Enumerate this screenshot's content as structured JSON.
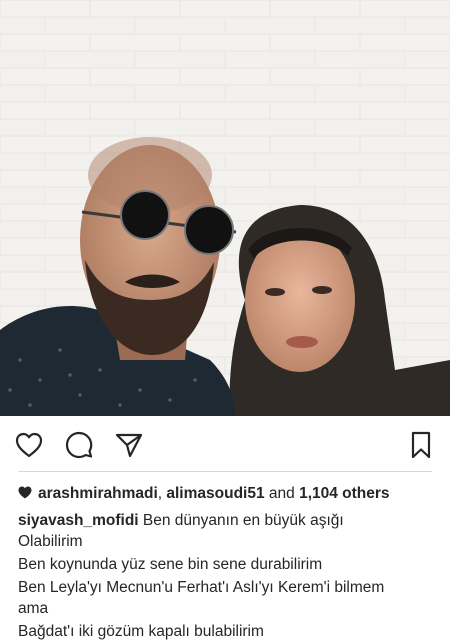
{
  "post": {
    "likes": {
      "user_1": "arashmirahmadi",
      "separator": ", ",
      "user_2": "alimasoudi51",
      "and_text": " and ",
      "others_text": "1,104 others"
    },
    "caption": {
      "author": "siyavash_mofidi",
      "line_1": "Ben dünyanın en büyük aşığı",
      "line_2": "Olabilirim",
      "line_3": "Ben koynunda yüz sene bin sene durabilirim",
      "line_4": "Ben Leyla'yı Mecnun'u Ferhat'ı Aslı'yı Kerem'i bilmem",
      "line_5": "ama",
      "line_6": "Bağdat'ı iki gözüm kapalı bulabilirim"
    }
  },
  "icons": {
    "like": "heart-outline-icon",
    "comment": "speech-bubble-icon",
    "share": "paper-plane-icon",
    "save": "bookmark-icon",
    "likes_marker": "heart-filled-icon"
  },
  "colors": {
    "text": "#262626",
    "icon": "#262626",
    "divider": "#d9d9d9",
    "wall": "#e9e7e3"
  }
}
